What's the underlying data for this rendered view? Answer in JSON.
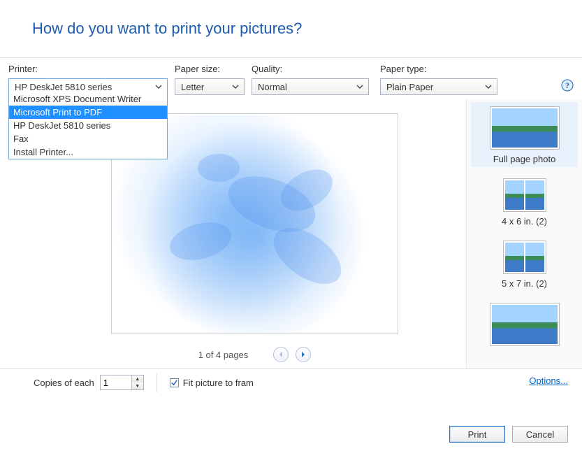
{
  "title": "How do you want to print your pictures?",
  "labels": {
    "printer": "Printer:",
    "paper_size": "Paper size:",
    "quality": "Quality:",
    "paper_type": "Paper type:",
    "copies": "Copies of each",
    "fit": "Fit picture to fram",
    "options_link": "Options..."
  },
  "dropdowns": {
    "printer": {
      "value": "HP DeskJet 5810 series",
      "items": [
        "Microsoft XPS Document Writer",
        "Microsoft Print to PDF",
        "HP DeskJet 5810 series",
        "Fax",
        "Install Printer..."
      ],
      "highlighted_index": 1
    },
    "paper_size": {
      "value": "Letter"
    },
    "quality": {
      "value": "Normal"
    },
    "paper_type": {
      "value": "Plain Paper"
    }
  },
  "pager": {
    "text": "1 of 4 pages"
  },
  "layouts": [
    {
      "label": "Full page photo",
      "style": "full",
      "selected": true
    },
    {
      "label": "4 x 6 in. (2)",
      "style": "pair",
      "selected": false
    },
    {
      "label": "5 x 7 in. (2)",
      "style": "pair",
      "selected": false
    },
    {
      "label": "",
      "style": "full",
      "selected": false
    }
  ],
  "copies_value": "1",
  "fit_checked": true,
  "buttons": {
    "print": "Print",
    "cancel": "Cancel"
  }
}
